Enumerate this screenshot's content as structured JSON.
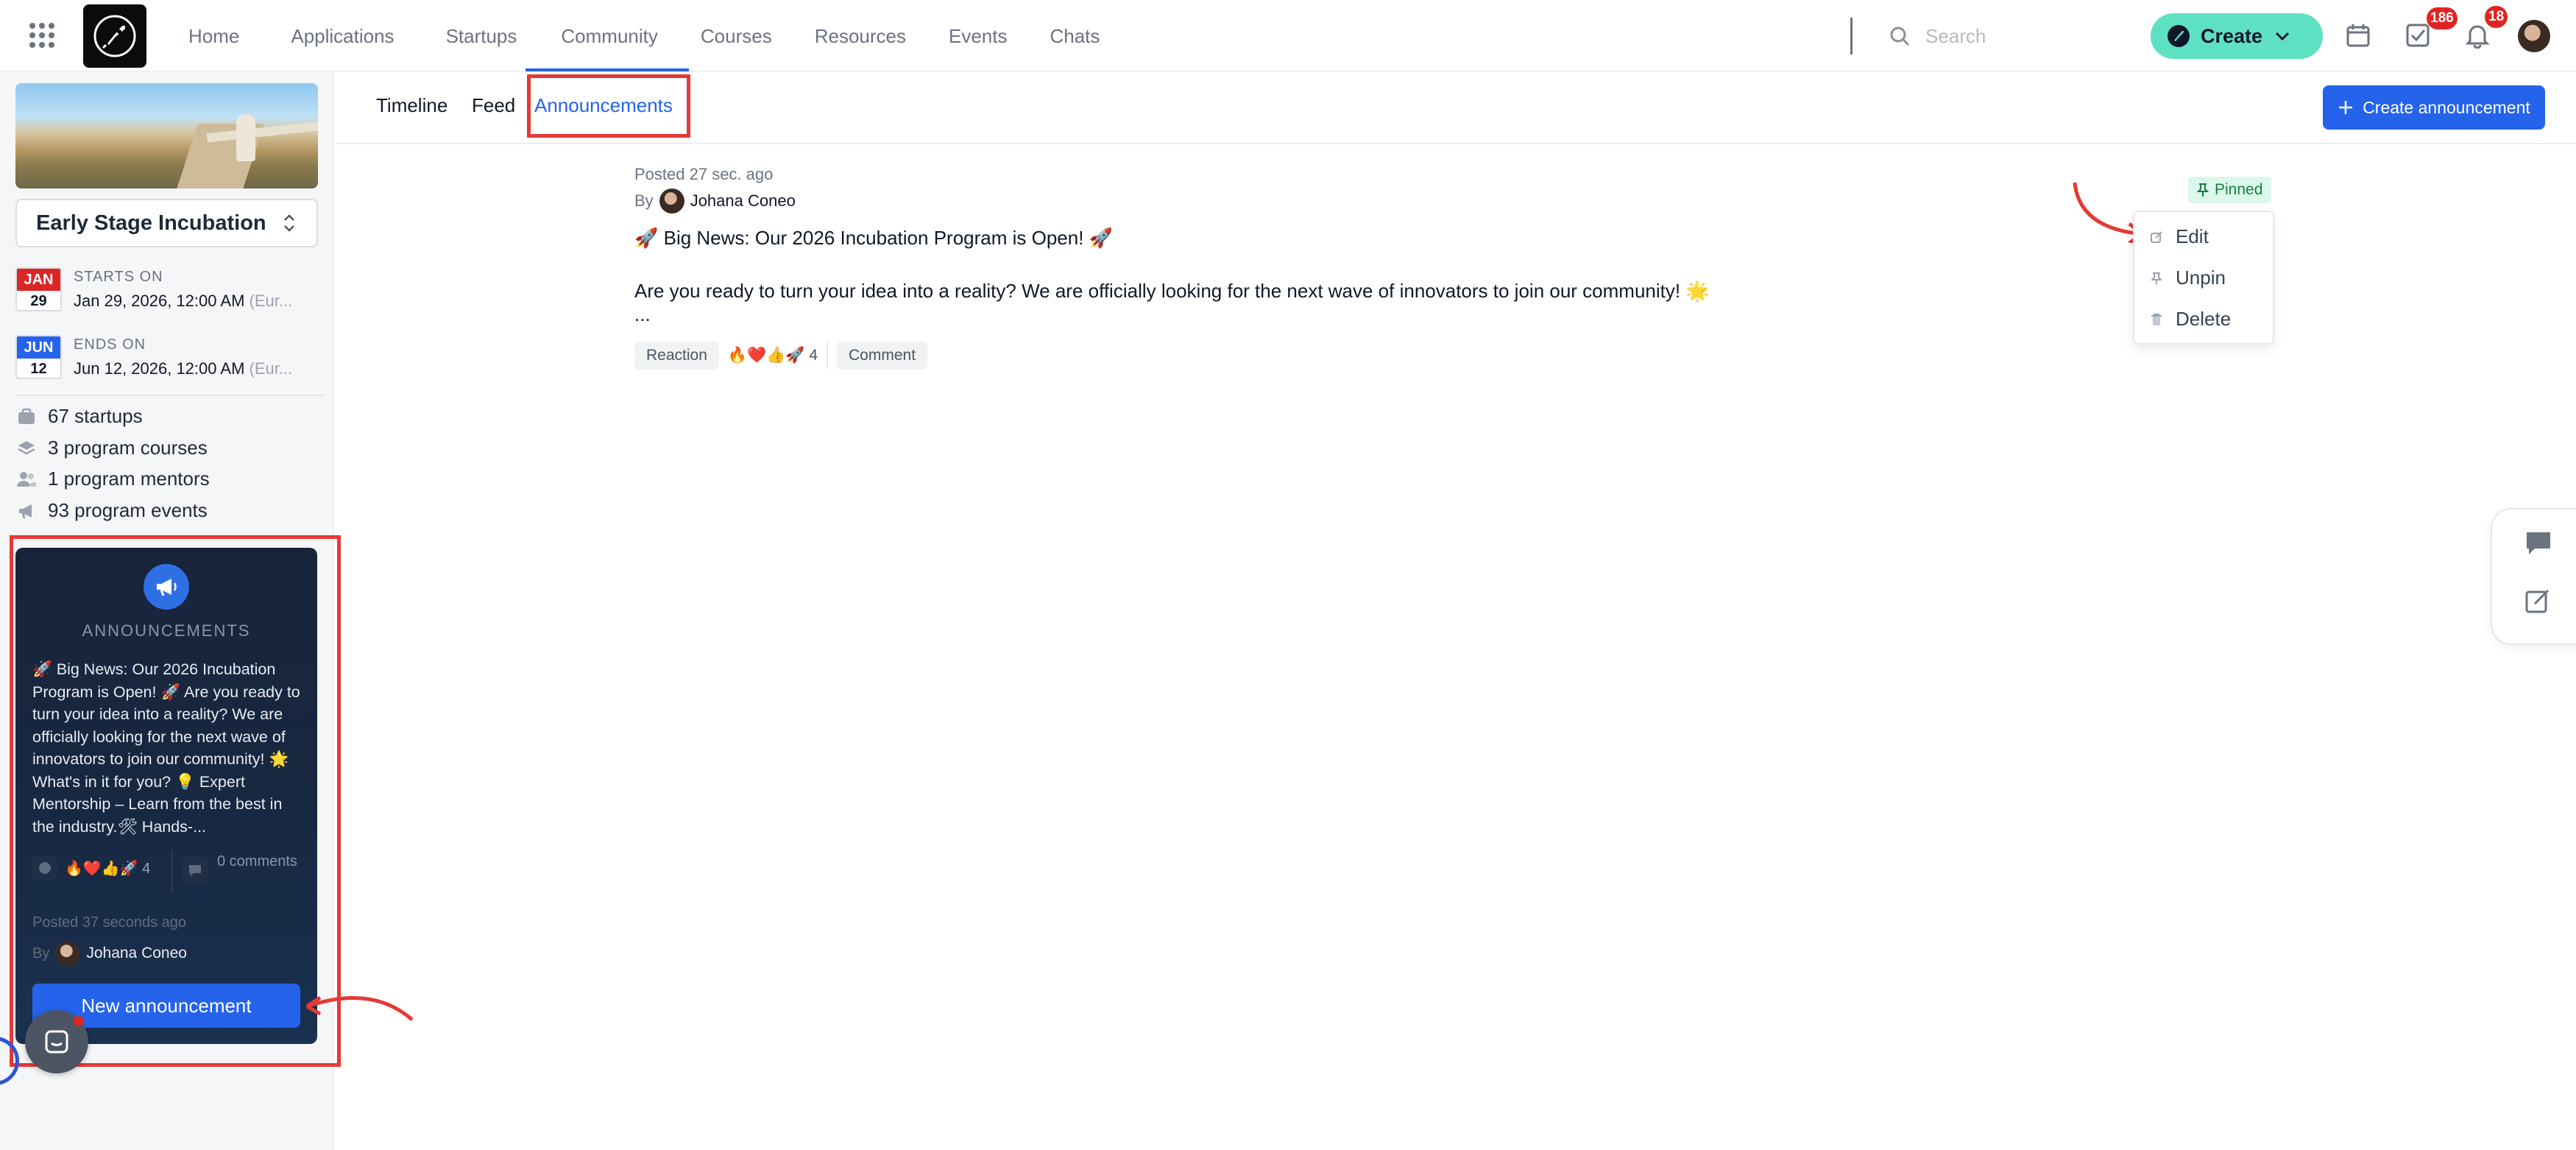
{
  "nav": {
    "items": [
      "Home",
      "Applications",
      "Startups",
      "Community",
      "Courses",
      "Resources",
      "Events",
      "Chats"
    ]
  },
  "search": {
    "placeholder": "Search"
  },
  "create_button": {
    "label": "Create"
  },
  "badges": {
    "tasks": "186",
    "notifications": "18"
  },
  "sidebar": {
    "program_name": "Early Stage Incubation",
    "starts": {
      "month": "JAN",
      "day": "29",
      "label": "STARTS ON",
      "value": "Jan 29, 2026, 12:00 AM",
      "tz": "(Eur..."
    },
    "ends": {
      "month": "JUN",
      "day": "12",
      "label": "ENDS ON",
      "value": "Jun 12, 2026, 12:00 AM",
      "tz": "(Eur..."
    },
    "stats": [
      "67 startups",
      "3 program courses",
      "1 program mentors",
      "93 program events"
    ],
    "announcement_card": {
      "title": "ANNOUNCEMENTS",
      "body": "🚀 Big News: Our 2026 Incubation Program is Open! 🚀 Are you ready to turn your idea into a reality? We are officially looking for the next wave of innovators to join our community! 🌟 What's in it for you? 💡 Expert Mentorship – Learn from the best in the industry.🛠 Hands-...",
      "reactions": "🔥❤️👍🚀 4",
      "comments": "0 comments",
      "posted": "Posted 37 seconds ago",
      "by_label": "By",
      "author": "Johana Coneo",
      "new_button": "New announcement"
    }
  },
  "tabs": [
    "Timeline",
    "Feed",
    "Announcements"
  ],
  "create_announcement": "Create announcement",
  "post": {
    "posted": "Posted 27 sec. ago",
    "by_label": "By",
    "author": "Johana Coneo",
    "headline": "🚀 Big News: Our 2026 Incubation Program is Open! 🚀",
    "paragraph": "Are you ready to turn your idea into a reality? We are officially looking for the next wave of innovators to join our community! 🌟",
    "ellipsis": "...",
    "reaction_label": "Reaction",
    "reactions": "🔥❤️👍🚀 4",
    "comment_label": "Comment",
    "pinned": "Pinned"
  },
  "menu": {
    "items": [
      "Edit",
      "Unpin",
      "Delete"
    ]
  },
  "colors": {
    "accent": "#2563eb",
    "create": "#5ee1c3",
    "highlight": "#e53935",
    "badge": "#e02424"
  },
  "icons": [
    "apps-grid-icon",
    "rocket-logo-icon",
    "search-icon",
    "chevron-down-icon",
    "calendar-icon",
    "tasks-icon",
    "bell-icon",
    "megaphone-icon",
    "pin-icon",
    "edit-icon",
    "trash-icon",
    "chat-icon",
    "plus-icon"
  ]
}
